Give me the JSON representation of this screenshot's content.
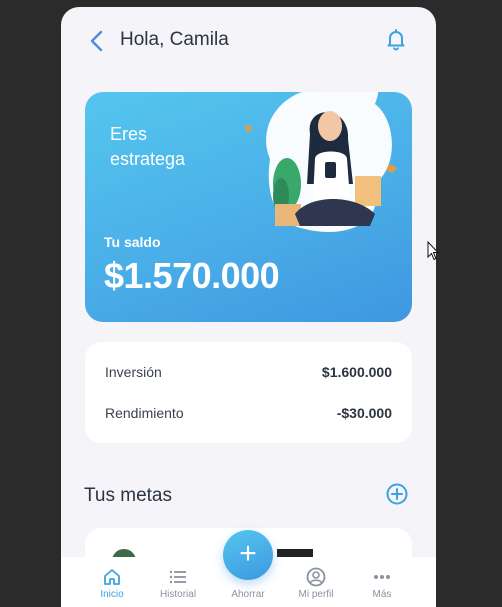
{
  "header": {
    "back_icon": "chevron-left-icon",
    "greeting": "Hola, Camila",
    "notification_icon": "bell-icon"
  },
  "balance_card": {
    "profile_tag": "Eres estratega",
    "balance_label": "Tu saldo",
    "balance_value": "$1.570.000"
  },
  "summary": [
    {
      "label": "Inversión",
      "value": "$1.600.000"
    },
    {
      "label": "Rendimiento",
      "value": "-$30.000"
    }
  ],
  "goals": {
    "title": "Tus metas",
    "add_icon": "plus-circle-icon"
  },
  "bottom_nav": {
    "fab_label": "+",
    "items": [
      {
        "label": "Inicio",
        "icon": "home-icon",
        "active": true
      },
      {
        "label": "Historial",
        "icon": "list-icon",
        "active": false
      },
      {
        "label": "Ahorrar",
        "icon": "plus-icon",
        "active": false
      },
      {
        "label": "Mi perfil",
        "icon": "user-icon",
        "active": false
      },
      {
        "label": "Más",
        "icon": "more-icon",
        "active": false
      }
    ]
  },
  "colors": {
    "accent": "#3da2e4",
    "card_gradient_start": "#55c6ee",
    "card_gradient_end": "#3f97e0",
    "background": "#f4f4f9"
  }
}
